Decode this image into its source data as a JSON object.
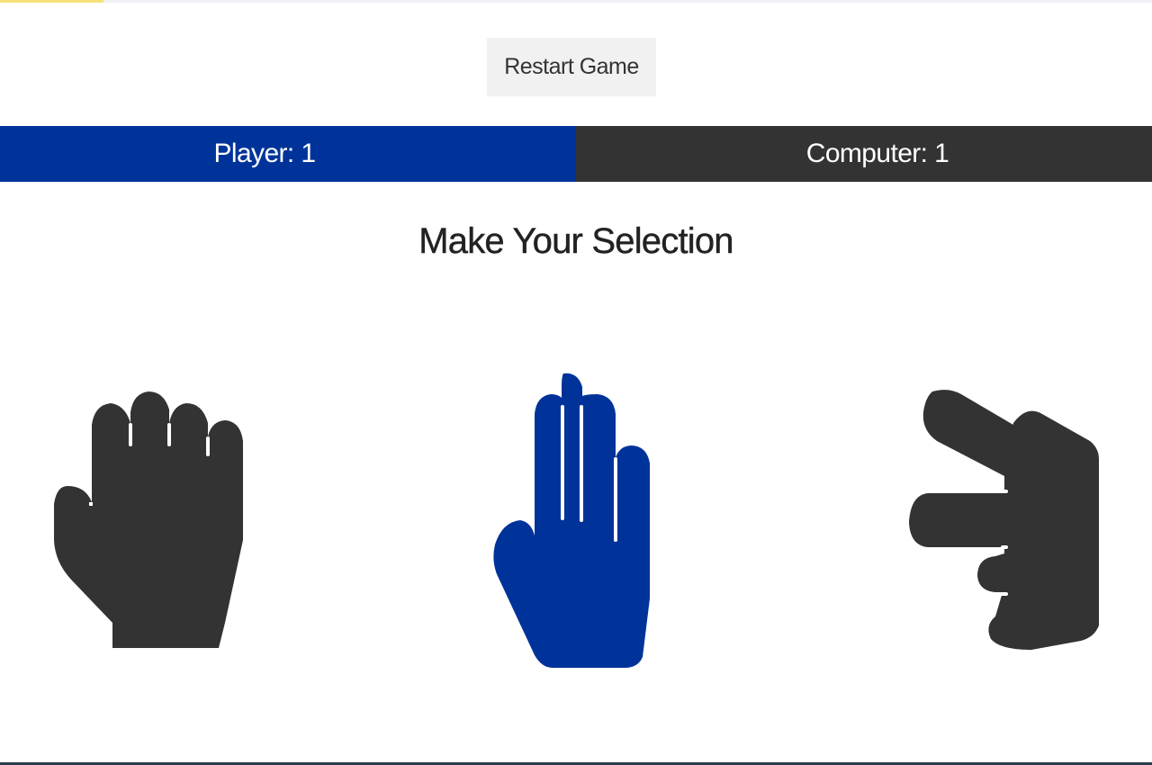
{
  "header": {
    "restart_label": "Restart Game"
  },
  "scoreboard": {
    "player_label": "Player: 1",
    "computer_label": "Computer: 1",
    "player_score": 1,
    "computer_score": 1
  },
  "main": {
    "title": "Make Your Selection",
    "choices": [
      {
        "name": "rock",
        "icon": "rock-hand-icon",
        "selected": false,
        "color": "#333333"
      },
      {
        "name": "paper",
        "icon": "paper-hand-icon",
        "selected": true,
        "color": "#00339a"
      },
      {
        "name": "scissors",
        "icon": "scissors-hand-icon",
        "selected": false,
        "color": "#333333"
      }
    ]
  },
  "colors": {
    "player_blue": "#00339a",
    "computer_dark": "#333333",
    "button_bg": "#f1f1f1"
  }
}
